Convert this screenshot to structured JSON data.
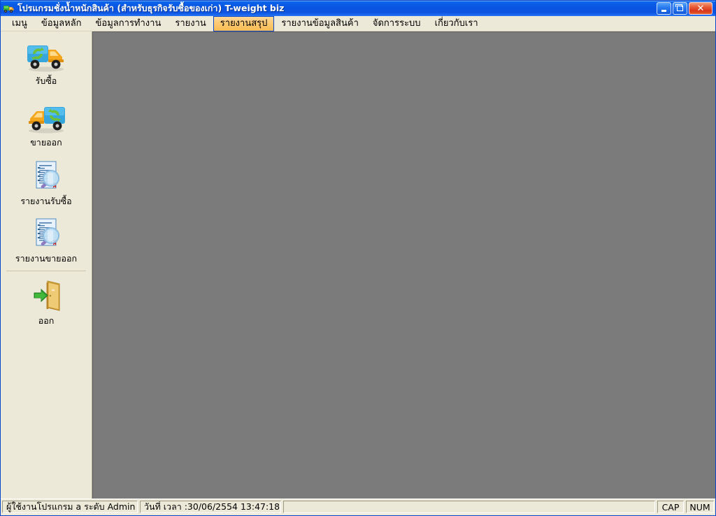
{
  "window": {
    "title": "โปรแกรมชั่งน้ำหนักสินค้า (สำหรับธุรกิจรับซื้อของเก่า) T-weight biz",
    "icon": "truck-icon",
    "controls": {
      "minimize_label": "_",
      "maximize_label": "❐",
      "close_label": "✕",
      "minimize_name": "minimize-button",
      "maximize_name": "restore-button",
      "close_name": "close-button"
    },
    "colors": {
      "title_gradient_top": "#1d7bf0",
      "title_gradient_bottom": "#0d53e0",
      "close_button": "#d8361a",
      "face": "#ece9d8",
      "client_area": "#7b7b7b",
      "menu_selected_bg": "#fcc86f",
      "menu_selected_border": "#0a46c8"
    }
  },
  "menubar": {
    "items": [
      {
        "label": "เมนู",
        "name": "menu-item-menu",
        "selected": false
      },
      {
        "label": "ข้อมูลหลัก",
        "name": "menu-item-master-data",
        "selected": false
      },
      {
        "label": "ข้อมูลการทำงาน",
        "name": "menu-item-work-data",
        "selected": false
      },
      {
        "label": "รายงาน",
        "name": "menu-item-reports",
        "selected": false
      },
      {
        "label": "รายงานสรุป",
        "name": "menu-item-summary-reports",
        "selected": true
      },
      {
        "label": "รายงานข้อมูลสินค้า",
        "name": "menu-item-product-reports",
        "selected": false
      },
      {
        "label": "จัดการระบบ",
        "name": "menu-item-system-management",
        "selected": false
      },
      {
        "label": "เกี่ยวกับเรา",
        "name": "menu-item-about-us",
        "selected": false
      }
    ]
  },
  "sidebar": {
    "items": [
      {
        "label": "รับซื้อ",
        "icon": "truck-buy-icon",
        "name": "sidebar-item-buy"
      },
      {
        "label": "ขายออก",
        "icon": "truck-sell-icon",
        "name": "sidebar-item-sell"
      },
      {
        "label": "รายงานรับซื้อ",
        "icon": "report-buy-icon",
        "name": "sidebar-item-buy-report"
      },
      {
        "label": "รายงานขายออก",
        "icon": "report-sell-icon",
        "name": "sidebar-item-sell-report"
      }
    ],
    "exit": {
      "label": "ออก",
      "icon": "exit-door-icon",
      "name": "sidebar-item-exit"
    }
  },
  "statusbar": {
    "user": "ผู้ใช้งานโปรแกรม a ระดับ   Admin",
    "datetime": "วันที่ เวลา :30/06/2554 13:47:18",
    "empty": "",
    "cap": "CAP",
    "num": "NUM"
  }
}
